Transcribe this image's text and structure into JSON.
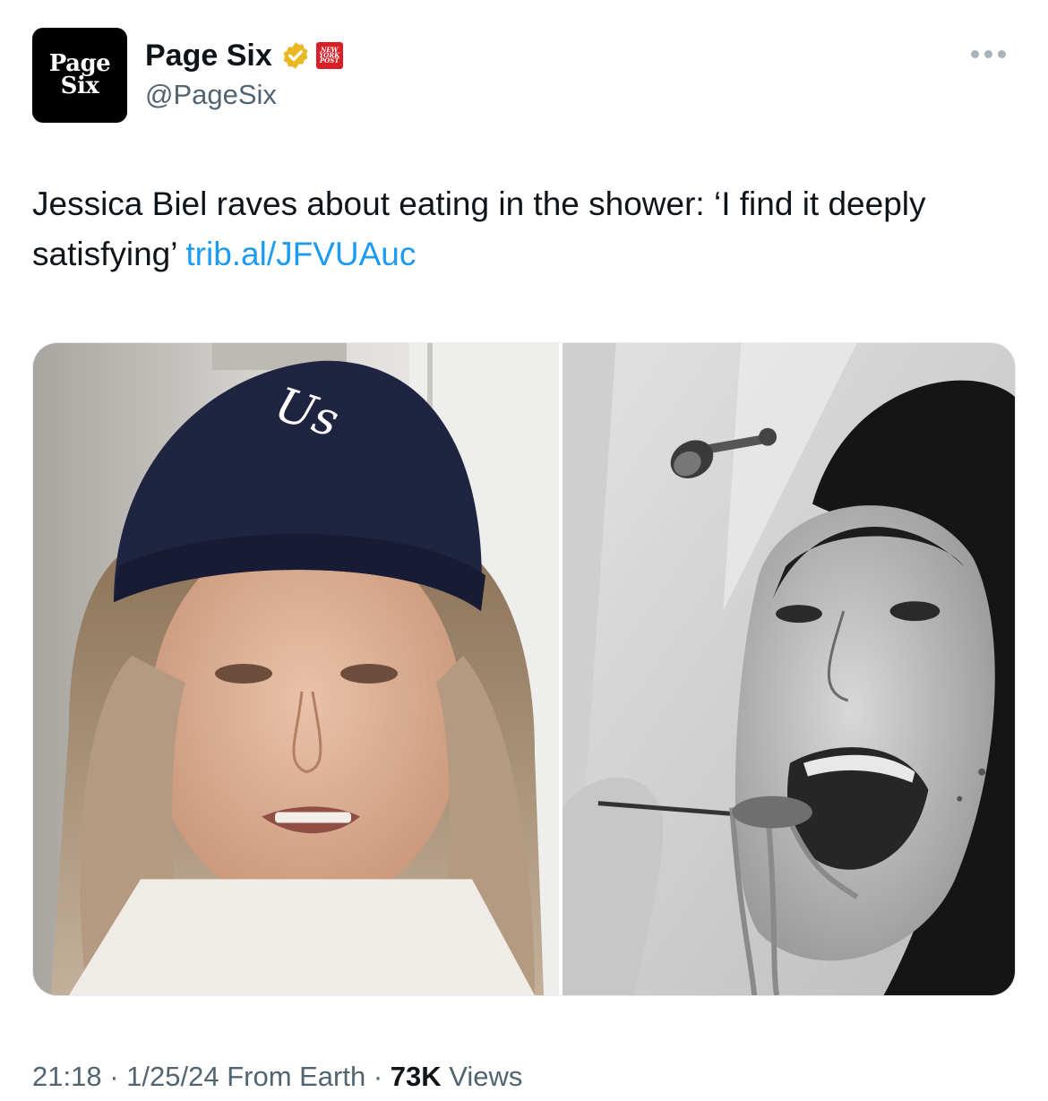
{
  "account": {
    "avatar_line1": "Page",
    "avatar_line2": "Six",
    "display_name": "Page Six",
    "handle": "@PageSix",
    "affiliate_badge": [
      "NEW",
      "YORK",
      "POST"
    ],
    "verified_color": "#e8b923"
  },
  "tweet": {
    "text": "Jessica Biel raves about eating in the shower: ‘I find it deeply satisfying’ ",
    "link": "trib.al/JFVUAuc"
  },
  "media": {
    "left_image": "woman-in-navy-beanie-photo",
    "right_image": "woman-eating-pasta-in-shower-bw-photo",
    "beanie_text": "Us"
  },
  "meta": {
    "time": "21:18",
    "sep1": " · ",
    "date": "1/25/24",
    "source": " From Earth",
    "sep2": " · ",
    "views_count": "73K",
    "views_label": " Views"
  },
  "colors": {
    "link": "#1d9bf0",
    "secondary_text": "#536471",
    "affiliate_red": "#d91f26"
  }
}
